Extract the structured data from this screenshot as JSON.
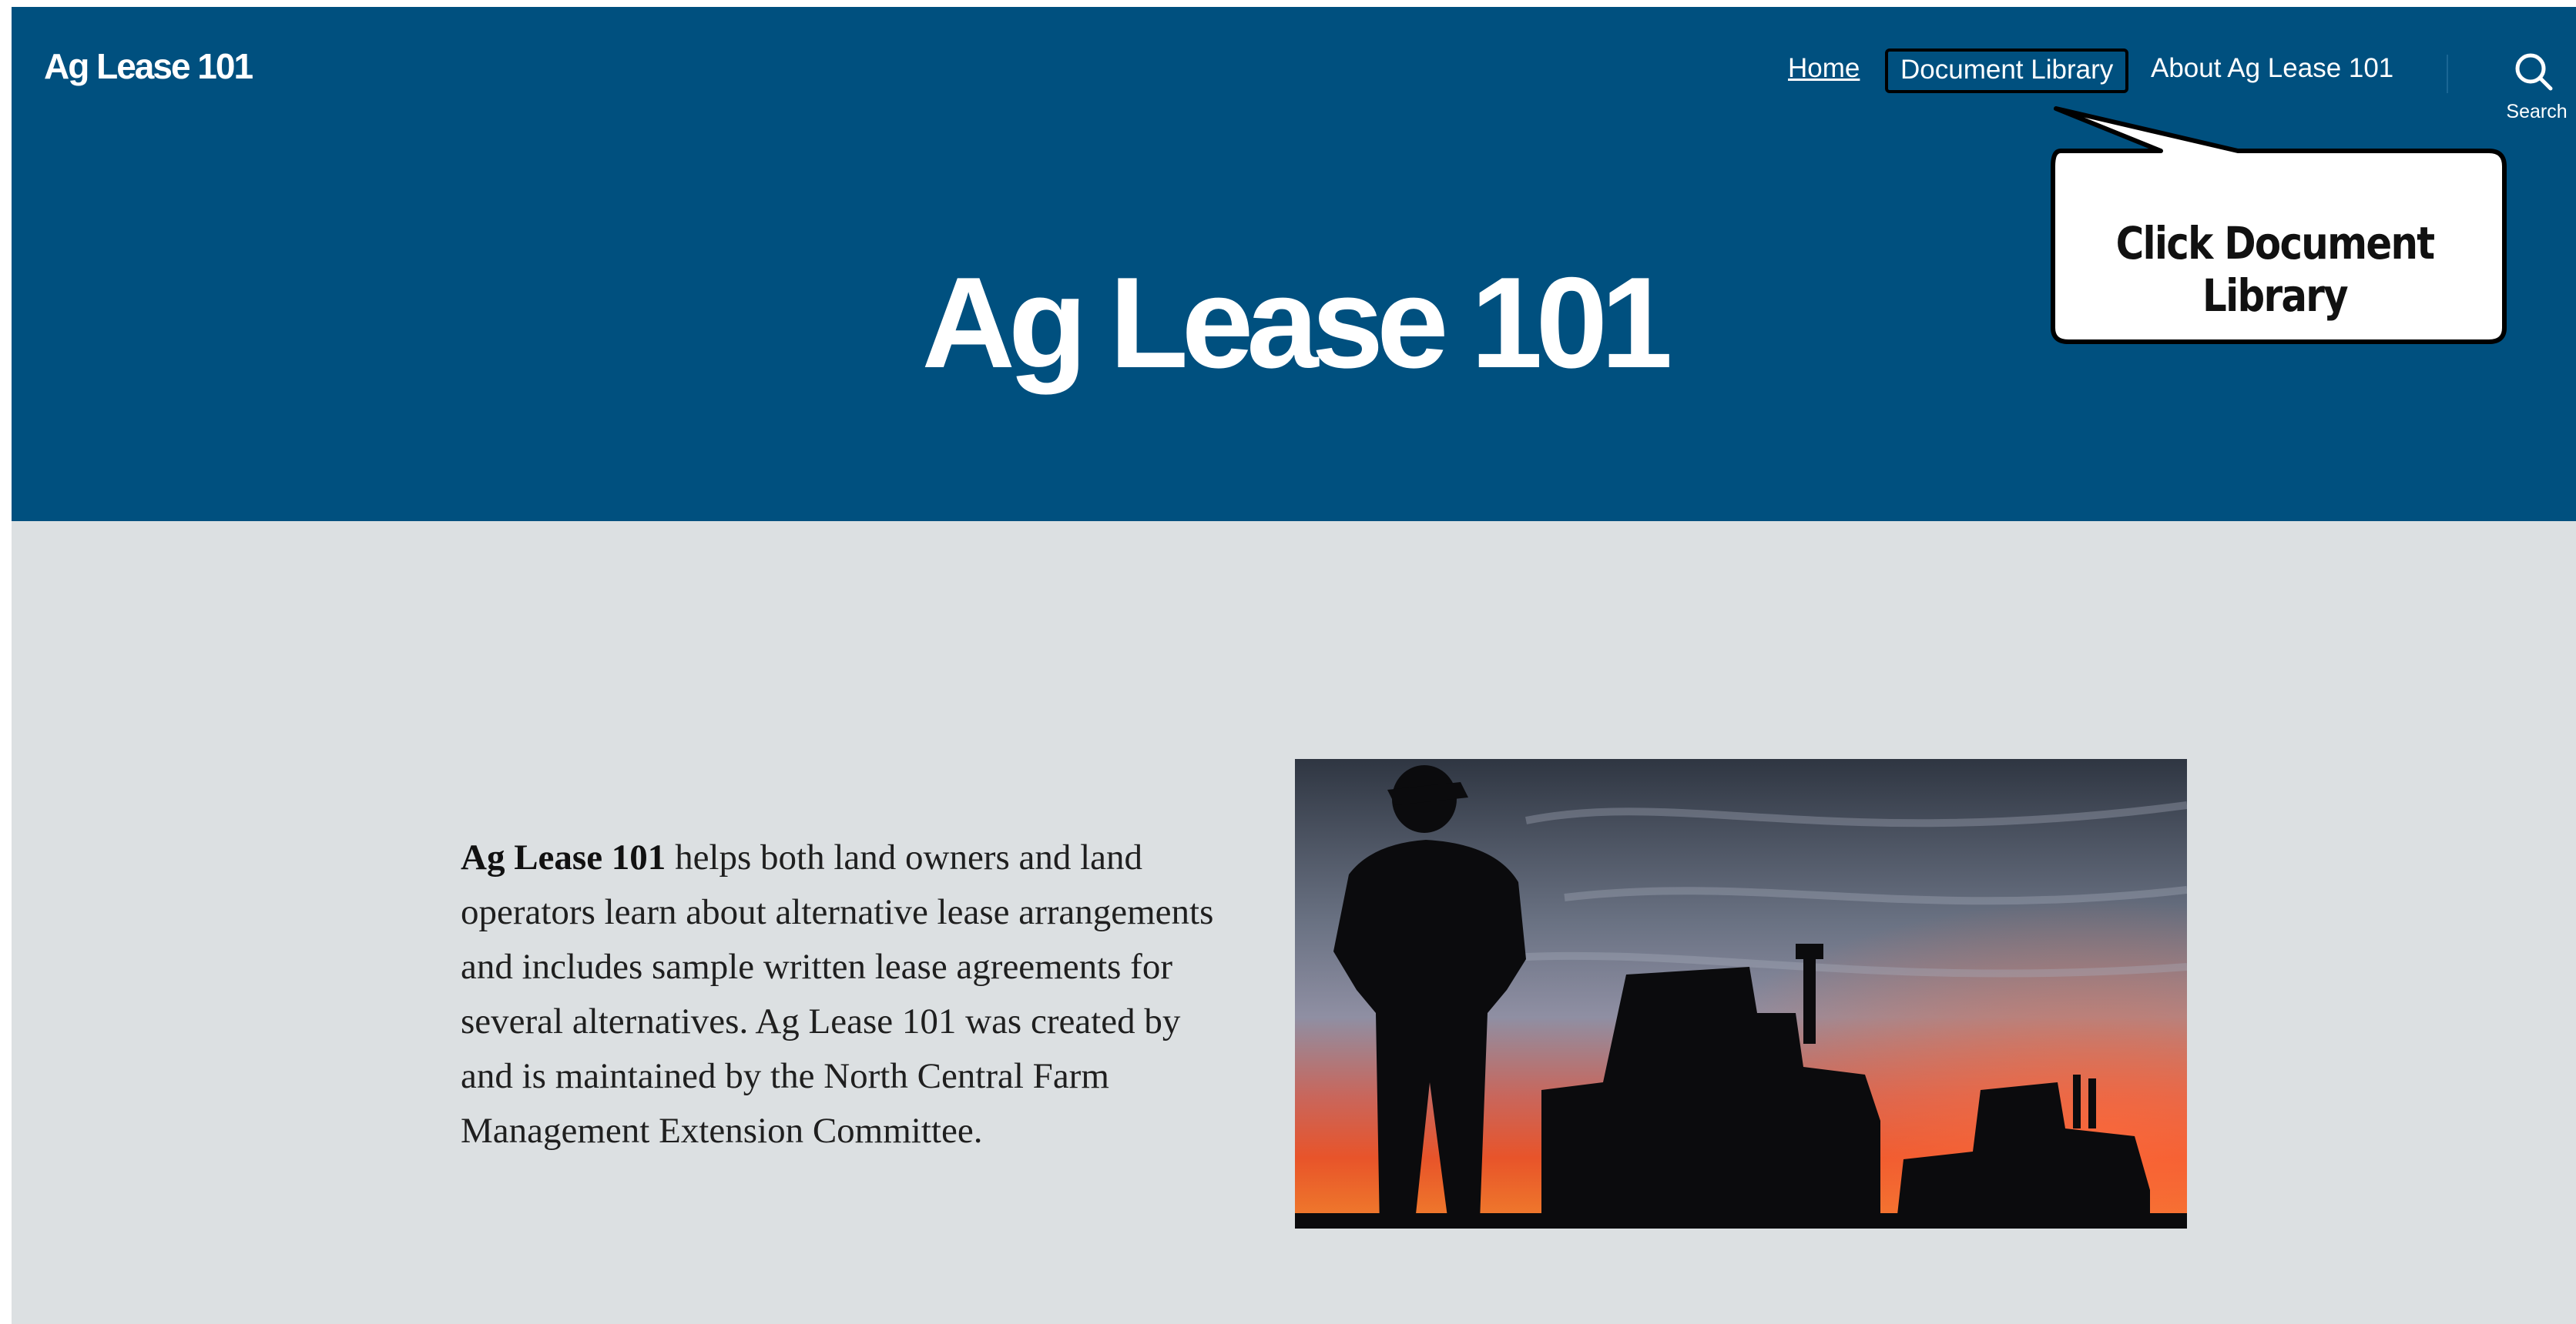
{
  "header": {
    "site_title": "Ag Lease 101",
    "nav": {
      "home": "Home",
      "document_library": "Document Library",
      "about": "About Ag Lease 101"
    },
    "search_label": "Search",
    "search_icon": "search-icon"
  },
  "hero": {
    "title": "Ag Lease 101"
  },
  "callout": {
    "text": "Click Document Library"
  },
  "content": {
    "intro_bold": "Ag Lease 101",
    "intro_text": " helps both land owners and land operators learn about alternative lease arrangements and includes sample written lease agreements for several alternatives. Ag Lease 101 was created by and is maintained by the North Central Farm Management Extension Committee."
  },
  "colors": {
    "header_bg": "#00507f",
    "page_bg": "#dce0e2",
    "text": "#1f1f1f"
  }
}
